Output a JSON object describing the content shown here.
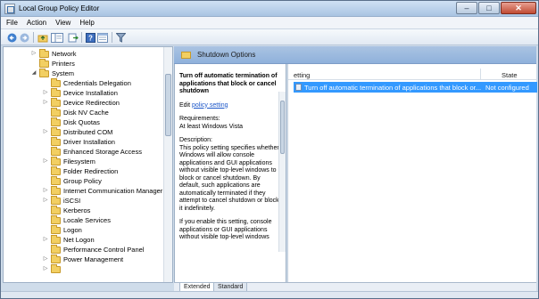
{
  "window": {
    "title": "Local Group Policy Editor"
  },
  "menu": [
    "File",
    "Action",
    "View",
    "Help"
  ],
  "toolbar": {
    "icons": [
      "back-arrow-icon",
      "forward-arrow-icon",
      "up-folder-icon",
      "show-hide-tree-icon",
      "export-list-icon",
      "help-icon",
      "properties-icon",
      "filter-icon"
    ]
  },
  "tree": {
    "items": [
      {
        "label": "Network",
        "expandable": true,
        "level": 1
      },
      {
        "label": "Printers",
        "expandable": false,
        "level": 1
      },
      {
        "label": "System",
        "expandable": true,
        "expanded": true,
        "level": 1
      },
      {
        "label": "Credentials Delegation",
        "expandable": false,
        "level": 2
      },
      {
        "label": "Device Installation",
        "expandable": true,
        "level": 2
      },
      {
        "label": "Device Redirection",
        "expandable": true,
        "level": 2
      },
      {
        "label": "Disk NV Cache",
        "expandable": false,
        "level": 2
      },
      {
        "label": "Disk Quotas",
        "expandable": false,
        "level": 2
      },
      {
        "label": "Distributed COM",
        "expandable": true,
        "level": 2
      },
      {
        "label": "Driver Installation",
        "expandable": false,
        "level": 2
      },
      {
        "label": "Enhanced Storage Access",
        "expandable": false,
        "level": 2
      },
      {
        "label": "Filesystem",
        "expandable": true,
        "level": 2
      },
      {
        "label": "Folder Redirection",
        "expandable": false,
        "level": 2
      },
      {
        "label": "Group Policy",
        "expandable": false,
        "level": 2
      },
      {
        "label": "Internet Communication Manager",
        "expandable": true,
        "level": 2
      },
      {
        "label": "iSCSI",
        "expandable": true,
        "level": 2
      },
      {
        "label": "Kerberos",
        "expandable": false,
        "level": 2
      },
      {
        "label": "Locale Services",
        "expandable": false,
        "level": 2
      },
      {
        "label": "Logon",
        "expandable": false,
        "level": 2
      },
      {
        "label": "Net Logon",
        "expandable": true,
        "level": 2
      },
      {
        "label": "Performance Control Panel",
        "expandable": false,
        "level": 2
      },
      {
        "label": "Power Management",
        "expandable": true,
        "level": 2
      }
    ]
  },
  "pane_header": {
    "title": "Shutdown Options"
  },
  "description": {
    "title": "Turn off automatic termination of applications that block or cancel shutdown",
    "edit_prefix": "Edit",
    "edit_link": "policy setting",
    "requirements_label": "Requirements:",
    "requirements_value": "At least Windows Vista",
    "description_label": "Description:",
    "description_text": "This policy setting specifies whether Windows will allow console applications and GUI applications without visible top-level windows to block or cancel shutdown. By default, such applications are automatically terminated if they attempt to cancel shutdown or block it indefinitely.",
    "more_text": "If you enable this setting, console applications or GUI applications without visible top-level windows"
  },
  "settings_list": {
    "columns": {
      "setting": "etting",
      "state": "State"
    },
    "rows": [
      {
        "setting": "Turn off automatic termination of applications that block or...",
        "state": "Not configured",
        "selected": true
      }
    ]
  },
  "tabs": [
    {
      "label": "Extended",
      "active": true
    },
    {
      "label": "Standard",
      "active": false
    }
  ],
  "colors": {
    "selection": "#3399ff",
    "link": "#1a55c8",
    "folder": "#f2cf62"
  }
}
